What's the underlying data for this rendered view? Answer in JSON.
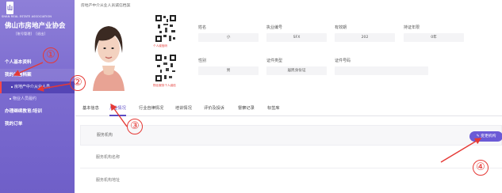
{
  "sidebar": {
    "logo_emblem": "山",
    "logo_en": "SHAN REAL ESTATE ASSOCIATION",
    "logo_cn": "佛山市房地产业协会",
    "links": [
      "[账号管理]",
      "[退出]"
    ],
    "nav": [
      {
        "label": "个人基本资料"
      },
      {
        "label": "我的诚信档案"
      },
      {
        "label": "房地产中介从业人员"
      },
      {
        "label": "物业人员履约"
      },
      {
        "label": "办理继续教育/培训"
      },
      {
        "label": "我的订单"
      }
    ]
  },
  "profile": {
    "title": "房地产中介从业人员诚信档案",
    "qr_caption_1": "个人诚信码",
    "qr_caption_2": "物业服务个人诚信",
    "fields": {
      "name_label": "姓名",
      "name_value": "小",
      "cert_no_label": "执业编号",
      "cert_no_value": "SFX",
      "valid_label": "有效期",
      "valid_value": "202",
      "years_label": "持证年限",
      "years_value": "0年",
      "gender_label": "性别",
      "gender_value": "男",
      "id_type_label": "证件类型",
      "id_type_value": "居民身份证",
      "id_no_label": "证件号码",
      "id_no_value": ""
    }
  },
  "tabs": [
    "基本信息",
    "从业情况",
    "行业自律情况",
    "培训情况",
    "评价及投诉",
    "督察记录",
    "标签库"
  ],
  "active_tab": "从业情况",
  "panel": {
    "head_label": "服务机构",
    "change_button": "变更机构",
    "rows": [
      "服务机构名称",
      "服务机构地址"
    ]
  },
  "annotations": {
    "markers": [
      "①",
      "②",
      "③",
      "④"
    ],
    "color": "#e53935"
  },
  "colors": {
    "sidebar": "#7c6cd0",
    "accent": "#5b4bc4",
    "button": "#6b5ad6"
  }
}
